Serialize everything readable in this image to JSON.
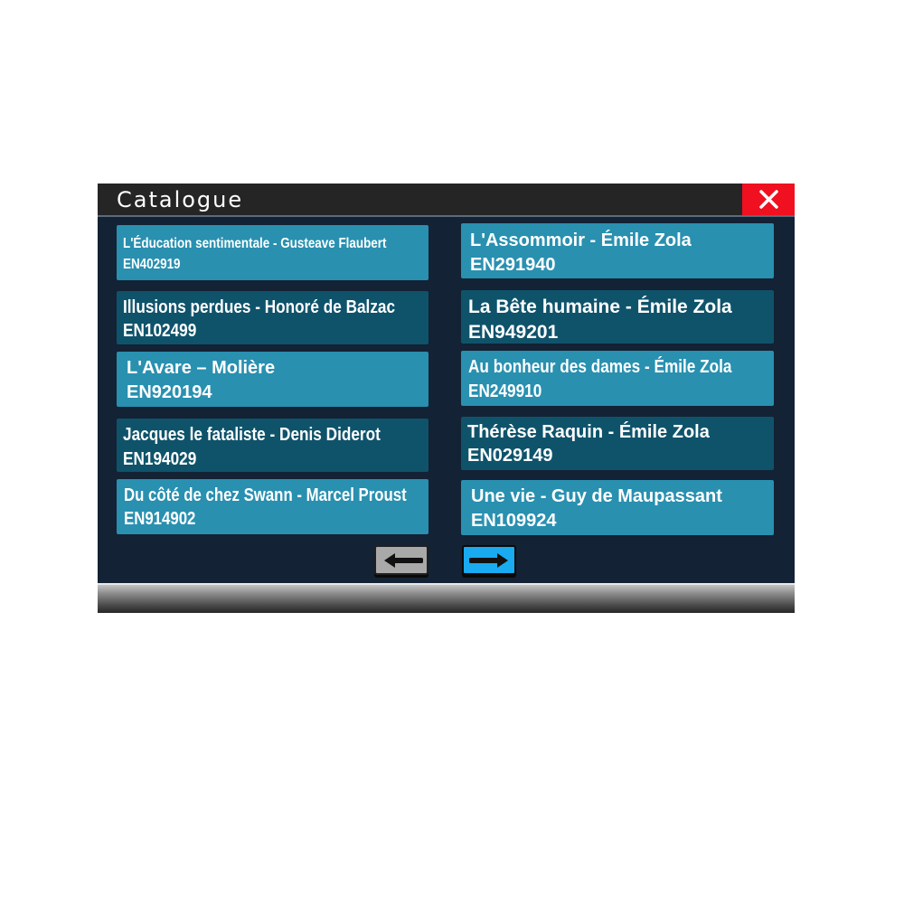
{
  "window": {
    "title": "Catalogue"
  },
  "books": [
    {
      "title": "L'Éducation sentimentale - Gusteave Flaubert",
      "code": "EN402919"
    },
    {
      "title": "L'Assommoir - Émile Zola",
      "code": "EN291940"
    },
    {
      "title": "Illusions perdues - Honoré de Balzac",
      "code": "EN102499"
    },
    {
      "title": "La Bête humaine - Émile Zola",
      "code": "EN949201"
    },
    {
      "title": "L'Avare – Molière",
      "code": "EN920194"
    },
    {
      "title": "Au bonheur des dames - Émile Zola",
      "code": "EN249910"
    },
    {
      "title": "Jacques le fataliste - Denis Diderot",
      "code": "EN194029"
    },
    {
      "title": "Thérèse Raquin - Émile Zola",
      "code": "EN029149"
    },
    {
      "title": "Du côté de chez Swann - Marcel Proust",
      "code": "EN914902"
    },
    {
      "title": "Une vie - Guy de Maupassant",
      "code": "EN109924"
    }
  ],
  "navigation": {
    "prev_icon": "arrow-left-icon",
    "next_icon": "arrow-right-icon",
    "close_icon": "close-icon"
  },
  "colors": {
    "title_bar": "#252525",
    "close_button": "#f01020",
    "panel_background": "#132234",
    "card_light": "#2990b0",
    "card_dark": "#0f536b",
    "next_button": "#19aaf0",
    "prev_button": "#a9a9a9"
  }
}
